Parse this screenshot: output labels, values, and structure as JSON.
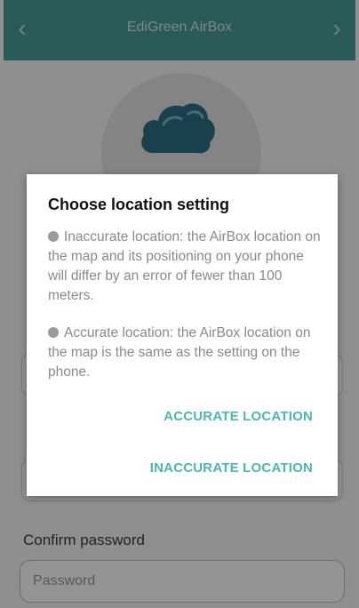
{
  "header": {
    "title": "EdiGreen AirBox",
    "back_glyph": "‹",
    "forward_glyph": "›"
  },
  "form": {
    "confirm_password_label": "Confirm password",
    "password_placeholder": "Password"
  },
  "dialog": {
    "title": "Choose location setting",
    "option_inaccurate": "Inaccurate location: the AirBox location on the map and its positioning on your phone will differ by an error of fewer than 100 meters.",
    "option_accurate": "Accurate location: the AirBox location on the map is the same as the setting on the phone.",
    "accurate_button": "ACCURATE LOCATION",
    "inaccurate_button": "INACCURATE LOCATION"
  },
  "colors": {
    "header": "#4a9e96",
    "accent": "#4bb8b0",
    "cloud": "#2b6f86"
  },
  "icons": {
    "cloud": "cloud-icon",
    "back": "chevron-left-icon",
    "forward": "chevron-right-icon"
  }
}
